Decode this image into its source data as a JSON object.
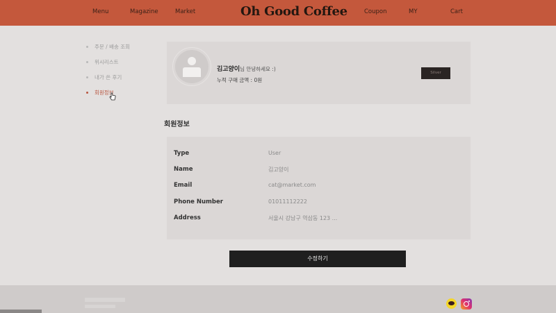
{
  "header": {
    "nav_left": [
      "Menu",
      "Magazine",
      "Market"
    ],
    "logo": "Oh Good Coffee",
    "nav_right": [
      "Coupon",
      "MY",
      "Cart"
    ]
  },
  "sidebar": {
    "items": [
      {
        "label": "주문 / 배송 조회"
      },
      {
        "label": "위시리스트"
      },
      {
        "label": "내가 쓴 후기"
      },
      {
        "label": "회원정보"
      }
    ],
    "active_index": 3
  },
  "profile": {
    "username": "김고양이",
    "greeting_suffix": "님 안녕하세요 :)",
    "purchase_text": "누적 구매 금액 : 0원",
    "badge": "Silver"
  },
  "member_info": {
    "title": "회원정보",
    "rows": [
      {
        "label": "Type",
        "value": "User"
      },
      {
        "label": "Name",
        "value": "김고양이"
      },
      {
        "label": "Email",
        "value": "cat@market.com"
      },
      {
        "label": "Phone Number",
        "value": "01011112222"
      },
      {
        "label": "Address",
        "value": "서울시 강남구 역삼동 123 ..."
      }
    ],
    "edit_button": "수정하기"
  },
  "footer": {
    "icons": [
      "kakao-icon",
      "instagram-icon"
    ]
  },
  "colors": {
    "header": "#c4583c",
    "accent": "#b8553f",
    "background": "#e3e0df",
    "card": "#dbd7d6",
    "button": "#1f1f1f"
  }
}
